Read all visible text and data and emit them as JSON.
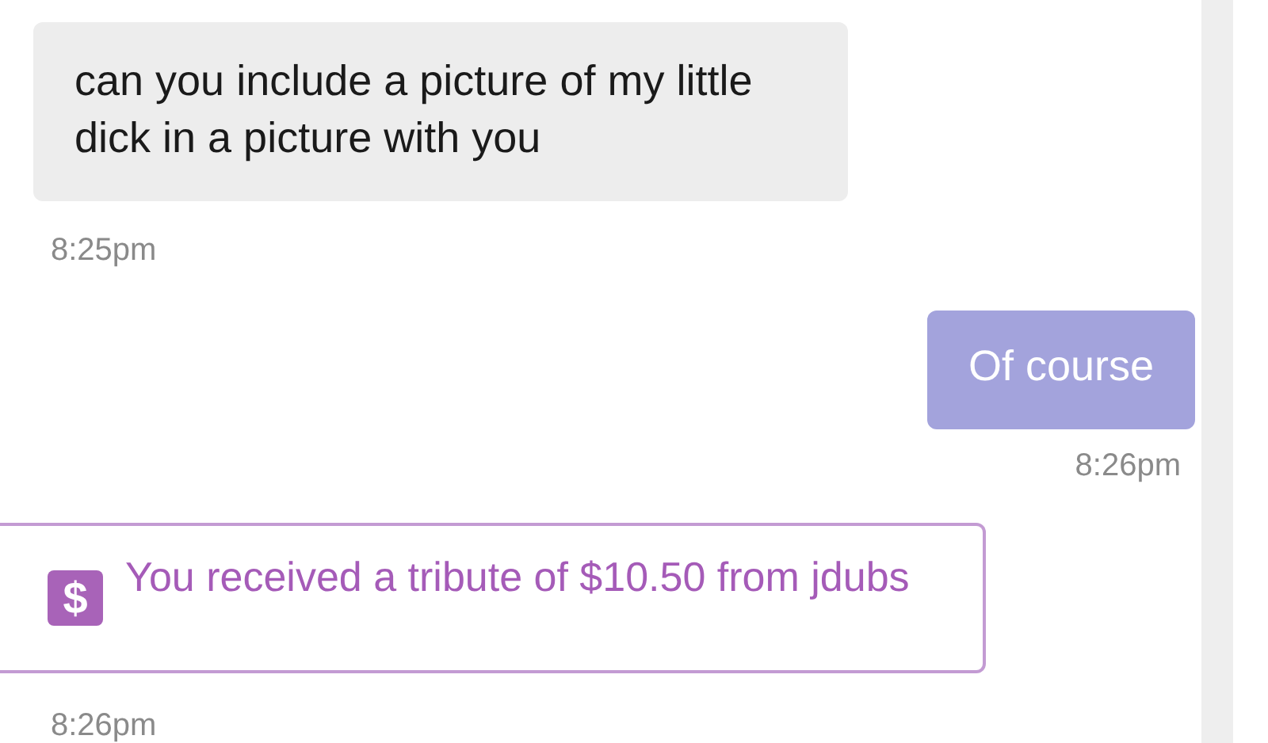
{
  "messages": [
    {
      "kind": "incoming",
      "text": "can you include a picture of my little dick in a picture with you",
      "time": "8:25pm"
    },
    {
      "kind": "outgoing",
      "text": "Of course",
      "time": "8:26pm"
    },
    {
      "kind": "tribute",
      "icon": "$",
      "text": "You received a tribute of $10.50 from jdubs",
      "time": "8:26pm"
    }
  ]
}
